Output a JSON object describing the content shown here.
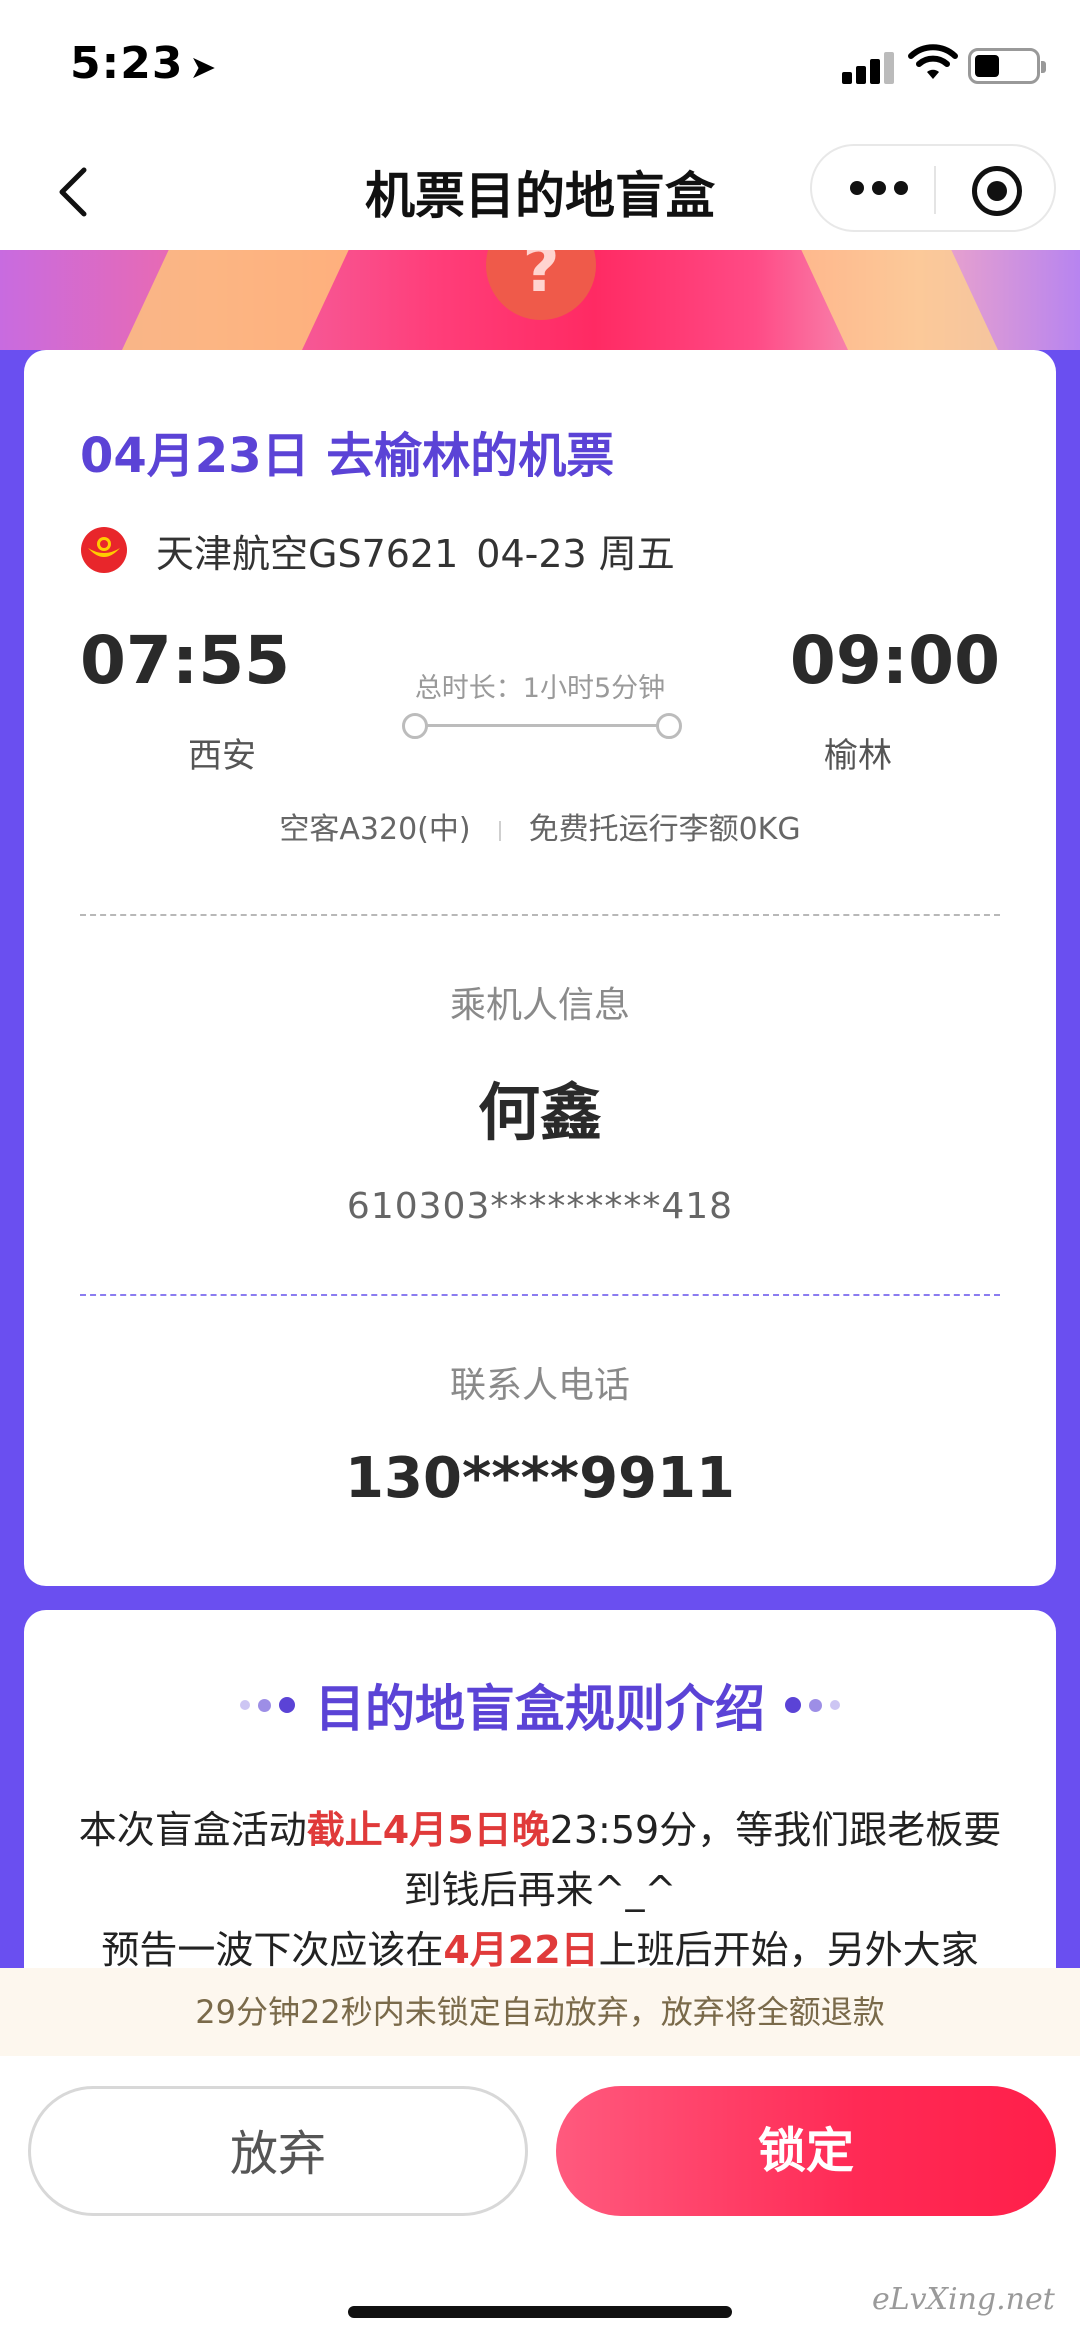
{
  "status_bar": {
    "time": "5:23",
    "location_glyph": "➤"
  },
  "nav": {
    "title": "机票目的地盲盒"
  },
  "ticket": {
    "title": "04月23日 去榆林的机票",
    "airline": "天津航空GS7621",
    "date": "04-23 周五",
    "dep_time": "07:55",
    "arr_time": "09:00",
    "dep_city": "西安",
    "arr_city": "榆林",
    "duration": "总时长：1小时5分钟",
    "aircraft": "空客A320(中)",
    "baggage": "免费托运行李额0KG"
  },
  "passenger": {
    "label": "乘机人信息",
    "name": "何鑫",
    "id_number": "610303*********418"
  },
  "contact": {
    "label": "联系人电话",
    "phone": "130****9911"
  },
  "rules": {
    "title": "目的地盲盒规则介绍",
    "line1_a": "本次盲盒活动",
    "line1_hl": "截止4月5日晚",
    "line1_b": "23:59分，等我们跟老板要到钱后再来^_^",
    "line2_a": "预告一波下次应该在",
    "line2_hl": "4月22日",
    "line2_b": "上班后开始，另外大家"
  },
  "countdown": {
    "text": "29分钟22秒内未锁定自动放弃，放弃将全额退款"
  },
  "actions": {
    "give_up": "放弃",
    "lock": "锁定"
  },
  "watermark": "eLvXing.net",
  "colors": {
    "accent": "#5b43d6",
    "background": "#6a4ff0",
    "lock_button": "#ff2a55",
    "highlight": "#e03a3a"
  },
  "icons": [
    "back-arrow-icon",
    "more-dots-icon",
    "target-icon",
    "airline-logo-icon",
    "signal-icon",
    "wifi-icon",
    "battery-icon"
  ]
}
